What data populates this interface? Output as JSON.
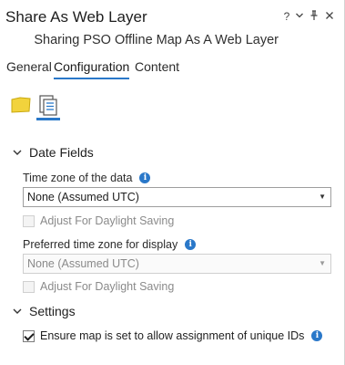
{
  "window": {
    "title": "Share As Web Layer",
    "controls": {
      "help": "?",
      "menu": "⌄",
      "pin": "⊥",
      "close": "✕"
    },
    "subtitle": "Sharing PSO Offline Map As A Web Layer"
  },
  "tabs": [
    {
      "label": "General",
      "active": false
    },
    {
      "label": "Configuration",
      "active": true
    },
    {
      "label": "Content",
      "active": false
    }
  ],
  "toolbar": {
    "items": [
      {
        "icon": "feature-layer-icon",
        "selected": false
      },
      {
        "icon": "properties-icon",
        "selected": true
      }
    ]
  },
  "date_fields": {
    "header": "Date Fields",
    "time_zone_label": "Time zone of the data",
    "time_zone_value": "None (Assumed UTC)",
    "dst_1_label": "Adjust For Daylight Saving",
    "dst_1_checked": false,
    "dst_1_enabled": false,
    "preferred_label": "Preferred time zone for display",
    "preferred_value": "None (Assumed UTC)",
    "dst_2_label": "Adjust For Daylight Saving",
    "dst_2_checked": false,
    "dst_2_enabled": false
  },
  "settings": {
    "header": "Settings",
    "unique_ids_label": "Ensure map is set to allow assignment of unique IDs",
    "unique_ids_checked": true
  },
  "colors": {
    "accent": "#2a78c9",
    "layer_icon": "#f2d33c"
  }
}
